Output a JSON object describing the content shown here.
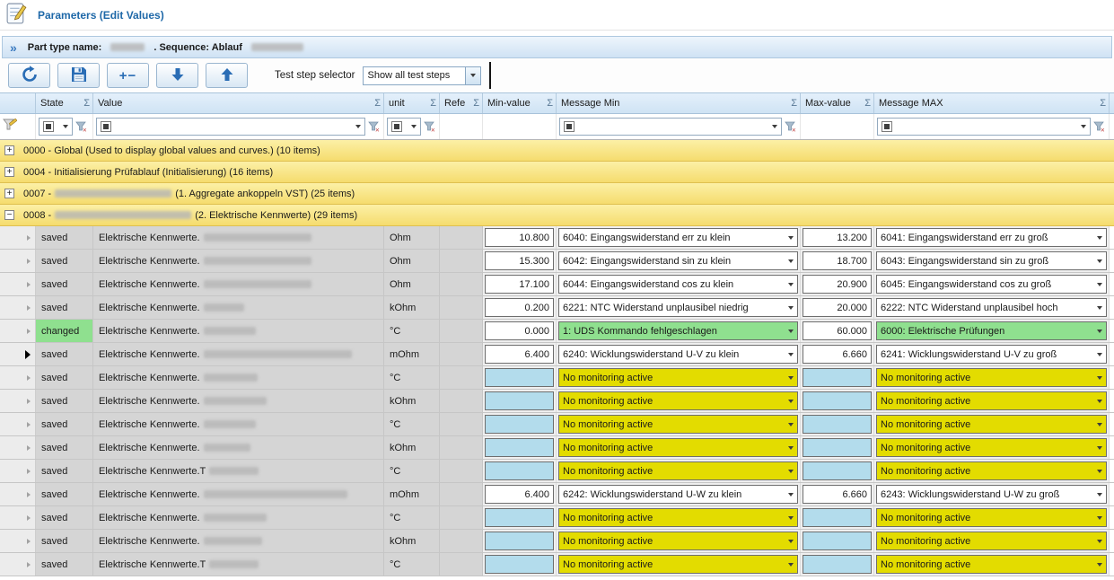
{
  "window": {
    "title": "Parameters (Edit Values)"
  },
  "part_bar": {
    "part_label": "Part type name:",
    "part_value_redact_w": 38,
    "sequence_label": ". Sequence: Ablauf",
    "sequence_value_redact_w": 58
  },
  "toolbar": {
    "add_remove_glyph": "+−",
    "selector_label": "Test step selector",
    "selector_value": "Show all test steps"
  },
  "grid": {
    "sigma": "Σ",
    "icons": {
      "collapsed_glyph": "+",
      "expanded_glyph": "−"
    },
    "columns": [
      {
        "label": ""
      },
      {
        "label": "State"
      },
      {
        "label": "Value"
      },
      {
        "label": "unit"
      },
      {
        "label": "Refe"
      },
      {
        "label": "Min-value"
      },
      {
        "label": "Message Min"
      },
      {
        "label": "Max-value"
      },
      {
        "label": "Message MAX"
      }
    ],
    "groups": [
      {
        "text_before": "0000 - Global (Used to display global values and curves.) (10 items)",
        "redact_w": 0,
        "text_after": "",
        "expanded": false
      },
      {
        "text_before": "0004 - Initialisierung Prüfablauf (Initialisierung) (16 items)",
        "redact_w": 0,
        "text_after": "",
        "expanded": false
      },
      {
        "text_before": "0007 -",
        "redact_w": 130,
        "text_after": "(1. Aggregate ankoppeln VST) (25 items)",
        "expanded": false
      },
      {
        "text_before": "0008 -",
        "redact_w": 152,
        "text_after": "(2. Elektrische Kennwerte) (29 items)",
        "expanded": true
      }
    ],
    "rows": [
      {
        "state": "saved",
        "changed": false,
        "current": false,
        "value_prefix": "Elektrische Kennwerte.",
        "redact_w": 120,
        "unit": "Ohm",
        "min": "10.800",
        "msg_min": "6040: Eingangswiderstand err zu klein",
        "max": "13.200",
        "msg_max": "6041: Eingangswiderstand err zu groß",
        "style": "normal"
      },
      {
        "state": "saved",
        "changed": false,
        "current": false,
        "value_prefix": "Elektrische Kennwerte.",
        "redact_w": 120,
        "unit": "Ohm",
        "min": "15.300",
        "msg_min": "6042: Eingangswiderstand sin zu klein",
        "max": "18.700",
        "msg_max": "6043: Eingangswiderstand sin zu groß",
        "style": "normal"
      },
      {
        "state": "saved",
        "changed": false,
        "current": false,
        "value_prefix": "Elektrische Kennwerte.",
        "redact_w": 120,
        "unit": "Ohm",
        "min": "17.100",
        "msg_min": "6044: Eingangswiderstand cos zu klein",
        "max": "20.900",
        "msg_max": "6045: Eingangswiderstand cos zu groß",
        "style": "normal"
      },
      {
        "state": "saved",
        "changed": false,
        "current": false,
        "value_prefix": "Elektrische Kennwerte.",
        "redact_w": 45,
        "unit": "kOhm",
        "min": "0.200",
        "msg_min": "6221: NTC Widerstand unplausibel niedrig",
        "max": "20.000",
        "msg_max": "6222: NTC Widerstand unplausibel hoch",
        "style": "normal"
      },
      {
        "state": "changed",
        "changed": true,
        "current": false,
        "value_prefix": "Elektrische Kennwerte.",
        "redact_w": 58,
        "unit": "°C",
        "min": "0.000",
        "msg_min": "1: UDS  Kommando fehlgeschlagen",
        "max": "60.000",
        "msg_max": "6000: Elektrische Prüfungen",
        "style": "green"
      },
      {
        "state": "saved",
        "changed": false,
        "current": true,
        "value_prefix": "Elektrische Kennwerte.",
        "redact_w": 165,
        "unit": "mOhm",
        "min": "6.400",
        "msg_min": "6240: Wicklungswiderstand U-V zu klein",
        "max": "6.660",
        "msg_max": "6241: Wicklungswiderstand U-V zu groß",
        "style": "normal"
      },
      {
        "state": "saved",
        "changed": false,
        "current": false,
        "value_prefix": "Elektrische Kennwerte.",
        "redact_w": 60,
        "unit": "°C",
        "min": "",
        "msg_min": "No monitoring active",
        "max": "",
        "msg_max": "No monitoring active",
        "style": "yellow"
      },
      {
        "state": "saved",
        "changed": false,
        "current": false,
        "value_prefix": "Elektrische Kennwerte.",
        "redact_w": 70,
        "unit": "kOhm",
        "min": "",
        "msg_min": "No monitoring active",
        "max": "",
        "msg_max": "No monitoring active",
        "style": "yellow"
      },
      {
        "state": "saved",
        "changed": false,
        "current": false,
        "value_prefix": "Elektrische Kennwerte.",
        "redact_w": 58,
        "unit": "°C",
        "min": "",
        "msg_min": "No monitoring active",
        "max": "",
        "msg_max": "No monitoring active",
        "style": "yellow"
      },
      {
        "state": "saved",
        "changed": false,
        "current": false,
        "value_prefix": "Elektrische Kennwerte.",
        "redact_w": 52,
        "unit": "kOhm",
        "min": "",
        "msg_min": "No monitoring active",
        "max": "",
        "msg_max": "No monitoring active",
        "style": "yellow"
      },
      {
        "state": "saved",
        "changed": false,
        "current": false,
        "value_prefix": "Elektrische Kennwerte.T",
        "redact_w": 55,
        "unit": "°C",
        "min": "",
        "msg_min": "No monitoring active",
        "max": "",
        "msg_max": "No monitoring active",
        "style": "yellow"
      },
      {
        "state": "saved",
        "changed": false,
        "current": false,
        "value_prefix": "Elektrische Kennwerte.",
        "redact_w": 160,
        "unit": "mOhm",
        "min": "6.400",
        "msg_min": "6242: Wicklungswiderstand U-W zu klein",
        "max": "6.660",
        "msg_max": "6243: Wicklungswiderstand U-W zu groß",
        "style": "normal"
      },
      {
        "state": "saved",
        "changed": false,
        "current": false,
        "value_prefix": "Elektrische Kennwerte.",
        "redact_w": 70,
        "unit": "°C",
        "min": "",
        "msg_min": "No monitoring active",
        "max": "",
        "msg_max": "No monitoring active",
        "style": "yellow"
      },
      {
        "state": "saved",
        "changed": false,
        "current": false,
        "value_prefix": "Elektrische Kennwerte.",
        "redact_w": 65,
        "unit": "kOhm",
        "min": "",
        "msg_min": "No monitoring active",
        "max": "",
        "msg_max": "No monitoring active",
        "style": "yellow"
      },
      {
        "state": "saved",
        "changed": false,
        "current": false,
        "value_prefix": "Elektrische Kennwerte.T",
        "redact_w": 55,
        "unit": "°C",
        "min": "",
        "msg_min": "No monitoring active",
        "max": "",
        "msg_max": "No monitoring active",
        "style": "yellow"
      }
    ]
  },
  "colors": {
    "accent_blue": "#1e68a8",
    "icon_blue": "#2a6db5",
    "header_bg": "#d9e9f8",
    "group_yellow": "#f5dc6e",
    "cell_gray": "#d5d5d5",
    "empty_blue": "#b3dcec",
    "monitor_yellow": "#e3dc00",
    "changed_green": "#8fe08f"
  }
}
